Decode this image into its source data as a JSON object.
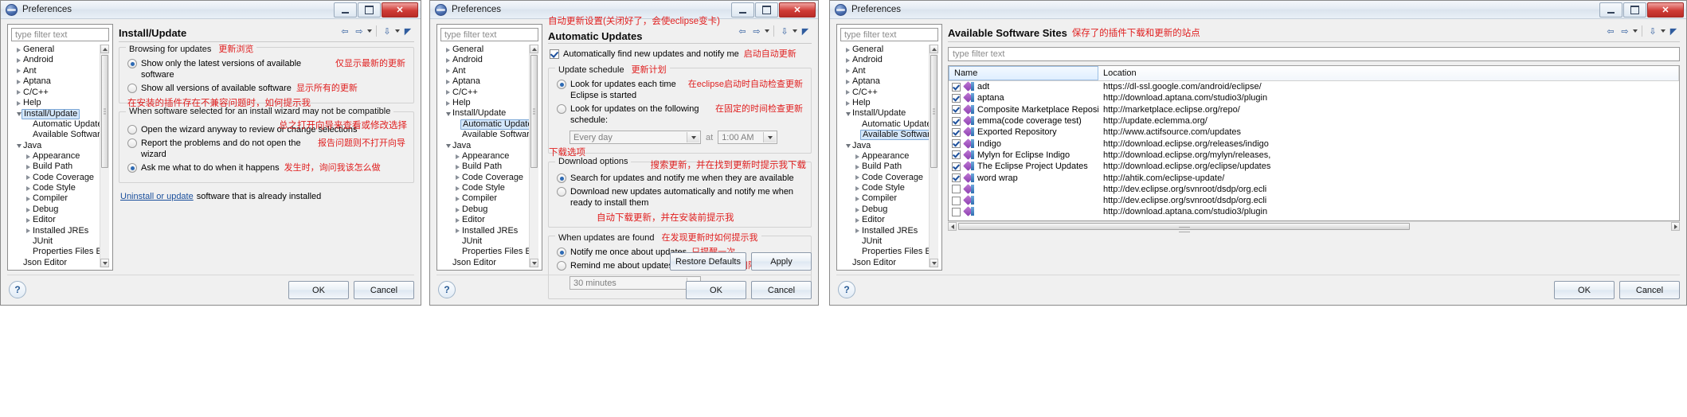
{
  "window1": {
    "title": "Preferences",
    "filter_placeholder": "type filter text",
    "tree": [
      {
        "label": "General",
        "state": "collapsed",
        "indent": 0
      },
      {
        "label": "Android",
        "state": "collapsed",
        "indent": 0
      },
      {
        "label": "Ant",
        "state": "collapsed",
        "indent": 0
      },
      {
        "label": "Aptana",
        "state": "collapsed",
        "indent": 0
      },
      {
        "label": "C/C++",
        "state": "collapsed",
        "indent": 0
      },
      {
        "label": "Help",
        "state": "collapsed",
        "indent": 0
      },
      {
        "label": "Install/Update",
        "state": "expanded",
        "indent": 0,
        "selected": true
      },
      {
        "label": "Automatic Updates",
        "state": "leaf",
        "indent": 1
      },
      {
        "label": "Available Software S",
        "state": "leaf",
        "indent": 1
      },
      {
        "label": "Java",
        "state": "expanded",
        "indent": 0
      },
      {
        "label": "Appearance",
        "state": "collapsed",
        "indent": 1
      },
      {
        "label": "Build Path",
        "state": "collapsed",
        "indent": 1
      },
      {
        "label": "Code Coverage",
        "state": "collapsed",
        "indent": 1
      },
      {
        "label": "Code Style",
        "state": "collapsed",
        "indent": 1
      },
      {
        "label": "Compiler",
        "state": "collapsed",
        "indent": 1
      },
      {
        "label": "Debug",
        "state": "collapsed",
        "indent": 1
      },
      {
        "label": "Editor",
        "state": "collapsed",
        "indent": 1
      },
      {
        "label": "Installed JREs",
        "state": "collapsed",
        "indent": 1
      },
      {
        "label": "JUnit",
        "state": "leaf",
        "indent": 1
      },
      {
        "label": "Properties Files Edito",
        "state": "leaf",
        "indent": 1
      },
      {
        "label": "Json Editor",
        "state": "leaf",
        "indent": 0
      }
    ],
    "page_title": "Install/Update",
    "group_browsing": {
      "legend": "Browsing for updates",
      "legend_cn": "更新浏览",
      "options": [
        {
          "label": "Show only the latest versions of available software",
          "cn": "仅显示最新的更新",
          "checked": true
        },
        {
          "label": "Show all versions of available software",
          "cn": "显示所有的更新",
          "checked": false
        }
      ]
    },
    "group_incompatible": {
      "legend": "When software selected for an install wizard may not be compatible",
      "legend_cn": "在安装的插件存在不兼容问题时，如何提示我",
      "note_cn": "总之打开向导来查看或修改选择",
      "options": [
        {
          "label": "Open the wizard anyway to review or change selections",
          "cn": "",
          "checked": false
        },
        {
          "label": "Report the problems and do not open the wizard",
          "cn": "报告问题则不打开向导",
          "checked": false
        },
        {
          "label": "Ask me what to do when it happens",
          "cn": "发生时，询问我该怎么做",
          "checked": true
        }
      ]
    },
    "uninstall_link": "Uninstall or update",
    "uninstall_rest": "software that is already installed",
    "buttons": {
      "ok": "OK",
      "cancel": "Cancel"
    }
  },
  "window2": {
    "title": "Preferences",
    "filter_placeholder": "type filter text",
    "tree": [
      {
        "label": "General",
        "state": "collapsed",
        "indent": 0
      },
      {
        "label": "Android",
        "state": "collapsed",
        "indent": 0
      },
      {
        "label": "Ant",
        "state": "collapsed",
        "indent": 0
      },
      {
        "label": "Aptana",
        "state": "collapsed",
        "indent": 0
      },
      {
        "label": "C/C++",
        "state": "collapsed",
        "indent": 0
      },
      {
        "label": "Help",
        "state": "collapsed",
        "indent": 0
      },
      {
        "label": "Install/Update",
        "state": "expanded",
        "indent": 0
      },
      {
        "label": "Automatic Updates",
        "state": "leaf",
        "indent": 1,
        "selected": true
      },
      {
        "label": "Available Software S",
        "state": "leaf",
        "indent": 1
      },
      {
        "label": "Java",
        "state": "expanded",
        "indent": 0
      },
      {
        "label": "Appearance",
        "state": "collapsed",
        "indent": 1
      },
      {
        "label": "Build Path",
        "state": "collapsed",
        "indent": 1
      },
      {
        "label": "Code Coverage",
        "state": "collapsed",
        "indent": 1
      },
      {
        "label": "Code Style",
        "state": "collapsed",
        "indent": 1
      },
      {
        "label": "Compiler",
        "state": "collapsed",
        "indent": 1
      },
      {
        "label": "Debug",
        "state": "collapsed",
        "indent": 1
      },
      {
        "label": "Editor",
        "state": "collapsed",
        "indent": 1
      },
      {
        "label": "Installed JREs",
        "state": "collapsed",
        "indent": 1
      },
      {
        "label": "JUnit",
        "state": "leaf",
        "indent": 1
      },
      {
        "label": "Properties Files Edito",
        "state": "leaf",
        "indent": 1
      },
      {
        "label": "Json Editor",
        "state": "leaf",
        "indent": 0
      }
    ],
    "page_title": "Automatic Updates",
    "page_title_cn": "自动更新设置(关闭好了，会使eclipse变卡)",
    "auto_find": {
      "label": "Automatically find new updates and notify me",
      "cn": "启动自动更新",
      "checked": true
    },
    "group_schedule": {
      "legend": "Update schedule",
      "legend_cn": "更新计划",
      "options": [
        {
          "label": "Look for updates each time Eclipse is started",
          "cn": "在eclipse启动时自动检查更新",
          "checked": true
        },
        {
          "label": "Look for updates on the following schedule:",
          "cn": "在固定的时间检查更新",
          "checked": false
        }
      ],
      "day_value": "Every day",
      "at_label": "at",
      "time_value": "1:00 AM"
    },
    "group_download": {
      "legend": "Download options",
      "legend_cn": "下载选项",
      "note_cn": "搜索更新，并在找到更新时提示我下载",
      "options": [
        {
          "label": "Search for updates and notify me when they are available",
          "cn": "",
          "checked": true
        },
        {
          "label": "Download new updates automatically and notify me when ready to install them",
          "cn": "自动下载更新，并在安装前提示我",
          "checked": false
        }
      ]
    },
    "group_found": {
      "legend": "When updates are found",
      "legend_cn": "在发现更新时如何提示我",
      "options": [
        {
          "label": "Notify me once about updates",
          "cn": "只提醒一次",
          "checked": true
        },
        {
          "label": "Remind me about updates every:",
          "cn": "每隔一个间隔就提示我",
          "checked": false
        }
      ],
      "interval_value": "30 minutes"
    },
    "buttons": {
      "restore": "Restore Defaults",
      "apply": "Apply",
      "ok": "OK",
      "cancel": "Cancel"
    }
  },
  "window3": {
    "title": "Preferences",
    "filter_placeholder": "type filter text",
    "tree": [
      {
        "label": "General",
        "state": "collapsed",
        "indent": 0
      },
      {
        "label": "Android",
        "state": "collapsed",
        "indent": 0
      },
      {
        "label": "Ant",
        "state": "collapsed",
        "indent": 0
      },
      {
        "label": "Aptana",
        "state": "collapsed",
        "indent": 0
      },
      {
        "label": "C/C++",
        "state": "collapsed",
        "indent": 0
      },
      {
        "label": "Help",
        "state": "collapsed",
        "indent": 0
      },
      {
        "label": "Install/Update",
        "state": "expanded",
        "indent": 0
      },
      {
        "label": "Automatic Updates",
        "state": "leaf",
        "indent": 1
      },
      {
        "label": "Available Software S",
        "state": "leaf",
        "indent": 1,
        "selected": true
      },
      {
        "label": "Java",
        "state": "expanded",
        "indent": 0
      },
      {
        "label": "Appearance",
        "state": "collapsed",
        "indent": 1
      },
      {
        "label": "Build Path",
        "state": "collapsed",
        "indent": 1
      },
      {
        "label": "Code Coverage",
        "state": "collapsed",
        "indent": 1
      },
      {
        "label": "Code Style",
        "state": "collapsed",
        "indent": 1
      },
      {
        "label": "Compiler",
        "state": "collapsed",
        "indent": 1
      },
      {
        "label": "Debug",
        "state": "collapsed",
        "indent": 1
      },
      {
        "label": "Editor",
        "state": "collapsed",
        "indent": 1
      },
      {
        "label": "Installed JREs",
        "state": "collapsed",
        "indent": 1
      },
      {
        "label": "JUnit",
        "state": "leaf",
        "indent": 1
      },
      {
        "label": "Properties Files Edito",
        "state": "leaf",
        "indent": 1
      },
      {
        "label": "Json Editor",
        "state": "leaf",
        "indent": 0
      }
    ],
    "page_title": "Available Software Sites",
    "page_title_cn": "保存了的插件下载和更新的站点",
    "table_filter_placeholder": "type filter text",
    "columns": [
      "Name",
      "Location"
    ],
    "rows": [
      {
        "checked": true,
        "name": "adt",
        "location": "https://dl-ssl.google.com/android/eclipse/"
      },
      {
        "checked": true,
        "name": "aptana",
        "location": "http://download.aptana.com/studio3/plugin"
      },
      {
        "checked": true,
        "name": "Composite Marketplace Repository",
        "location": "http://marketplace.eclipse.org/repo/"
      },
      {
        "checked": true,
        "name": "emma(code coverage test)",
        "location": "http://update.eclemma.org/"
      },
      {
        "checked": true,
        "name": "Exported Repository",
        "location": "http://www.actifsource.com/updates"
      },
      {
        "checked": true,
        "name": "Indigo",
        "location": "http://download.eclipse.org/releases/indigo"
      },
      {
        "checked": true,
        "name": "Mylyn for Eclipse Indigo",
        "location": "http://download.eclipse.org/mylyn/releases,"
      },
      {
        "checked": true,
        "name": "The Eclipse Project Updates",
        "location": "http://download.eclipse.org/eclipse/updates"
      },
      {
        "checked": true,
        "name": "word wrap",
        "location": "http://ahtik.com/eclipse-update/"
      },
      {
        "checked": false,
        "name": "",
        "location": "http://dev.eclipse.org/svnroot/dsdp/org.ecli"
      },
      {
        "checked": false,
        "name": "",
        "location": "http://dev.eclipse.org/svnroot/dsdp/org.ecli"
      },
      {
        "checked": false,
        "name": "",
        "location": "http://download.aptana.com/studio3/plugin"
      }
    ],
    "buttons": {
      "ok": "OK",
      "cancel": "Cancel"
    }
  },
  "icons": {
    "minimize": "minimize-icon",
    "maximize": "maximize-icon",
    "close": "✕",
    "help": "?",
    "back": "⇦",
    "forward": "⇨",
    "menu": "▾"
  }
}
